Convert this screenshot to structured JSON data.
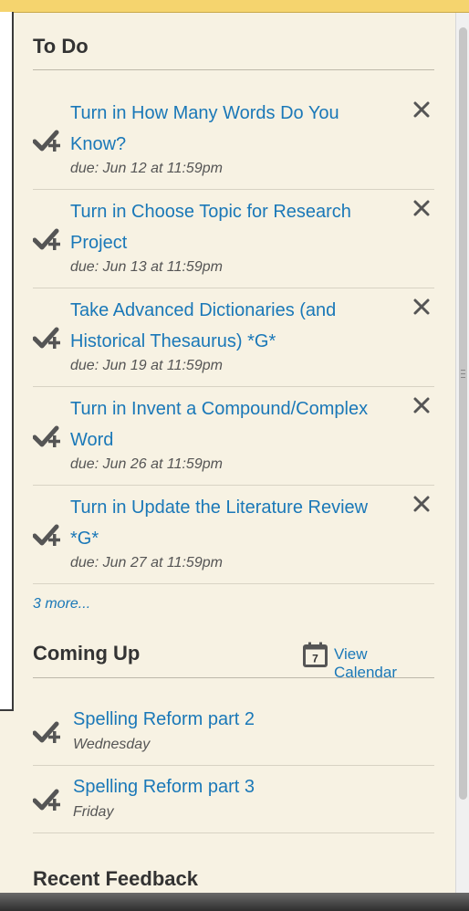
{
  "todo": {
    "title": "To Do",
    "items": [
      {
        "line1": "Turn in How Many Words Do You",
        "line2": "Know?",
        "due": "due: Jun 12 at 11:59pm"
      },
      {
        "line1": "Turn in Choose Topic for Research",
        "line2": "Project",
        "due": "due: Jun 13 at 11:59pm"
      },
      {
        "line1": "Take Advanced Dictionaries (and",
        "line2": "Historical Thesaurus) *G*",
        "due": "due: Jun 19 at 11:59pm"
      },
      {
        "line1": "Turn in Invent a Compound/Complex",
        "line2": "Word",
        "due": "due: Jun 26 at 11:59pm"
      },
      {
        "line1": "Turn in Update the Literature Review",
        "line2": "*G*",
        "due": "due: Jun 27 at 11:59pm"
      }
    ],
    "more_label": "3 more..."
  },
  "coming_up": {
    "title": "Coming Up",
    "calendar_day": "7",
    "view_calendar_label": "View Calendar",
    "items": [
      {
        "title": "Spelling Reform part 2",
        "day": "Wednesday"
      },
      {
        "title": "Spelling Reform part 3",
        "day": "Friday"
      }
    ]
  },
  "recent_feedback": {
    "title": "Recent Feedback"
  },
  "colors": {
    "background": "#f7f2e3",
    "link": "#1a78b8",
    "heading": "#333333",
    "icon": "#555555",
    "top_bar": "#f5d46e"
  },
  "icons": {
    "todo_item": "checkmark-plus-icon",
    "dismiss": "close-icon",
    "calendar": "calendar-icon"
  }
}
